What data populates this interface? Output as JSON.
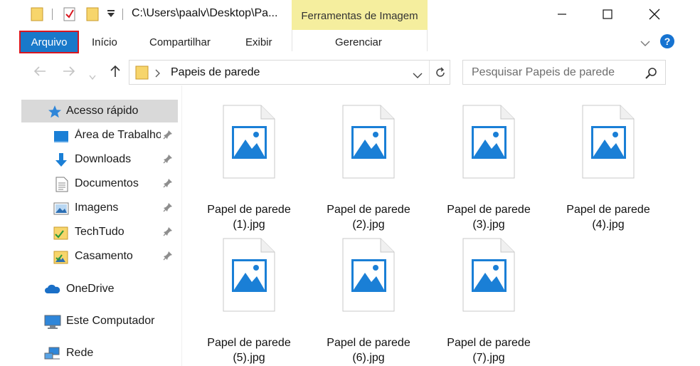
{
  "titlebar": {
    "path": "C:\\Users\\paalv\\Desktop\\Pa...",
    "context_tab": "Ferramentas de Imagem"
  },
  "ribbon": {
    "tabs": [
      "Arquivo",
      "Início",
      "Compartilhar",
      "Exibir",
      "Gerenciar"
    ],
    "active_tab": "Arquivo"
  },
  "address": {
    "path": "Papeis de parede",
    "search_placeholder": "Pesquisar Papeis de parede"
  },
  "nav": {
    "quick_access": "Acesso rápido",
    "quick_items": [
      "Área de Trabalho",
      "Downloads",
      "Documentos",
      "Imagens",
      "TechTudo",
      "Casamento"
    ],
    "onedrive": "OneDrive",
    "computer": "Este Computador",
    "network": "Rede"
  },
  "files": [
    {
      "line1": "Papel de parede",
      "line2": "(1).jpg"
    },
    {
      "line1": "Papel de parede",
      "line2": "(2).jpg"
    },
    {
      "line1": "Papel de parede",
      "line2": "(3).jpg"
    },
    {
      "line1": "Papel de parede",
      "line2": "(4).jpg"
    },
    {
      "line1": "Papel de parede",
      "line2": "(5).jpg"
    },
    {
      "line1": "Papel de parede",
      "line2": "(6).jpg"
    },
    {
      "line1": "Papel de parede",
      "line2": "(7).jpg"
    }
  ],
  "colors": {
    "accent": "#1979ca",
    "highlight_border": "#d9161f",
    "context_tab_bg": "#f5ee9e",
    "image_icon_blue": "#1a7fd6",
    "help_blue": "#1673d1"
  }
}
